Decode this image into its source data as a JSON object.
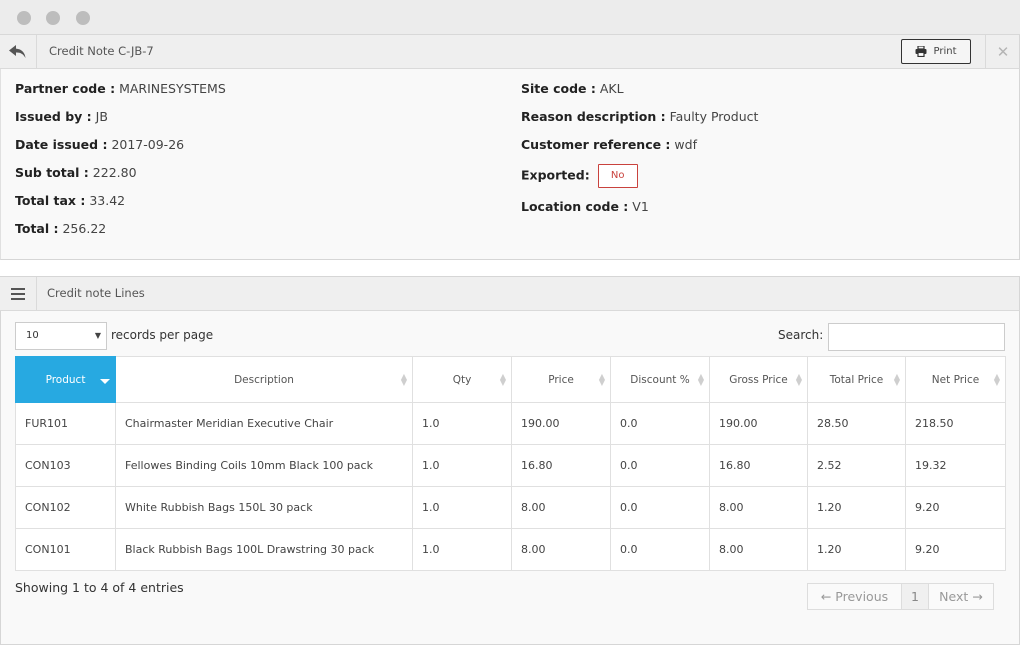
{
  "window": {
    "controls": [
      "close",
      "minimize",
      "maximize"
    ]
  },
  "header": {
    "back_icon": "reply-arrow-icon",
    "title": "Credit Note C-JB-7",
    "print_label": "Print",
    "print_icon": "printer-icon",
    "close_icon": "close-x-icon"
  },
  "details": {
    "left": [
      {
        "label": "Partner code :",
        "value": "MARINESYSTEMS"
      },
      {
        "label": "Issued by :",
        "value": "JB"
      },
      {
        "label": "Date issued :",
        "value": "2017-09-26"
      },
      {
        "label": "Sub total :",
        "value": "222.80"
      },
      {
        "label": "Total tax :",
        "value": "33.42"
      },
      {
        "label": "Total :",
        "value": "256.22"
      }
    ],
    "right": {
      "site_code": {
        "label": "Site code :",
        "value": "AKL"
      },
      "reason": {
        "label": "Reason description :",
        "value": "Faulty Product"
      },
      "customer_ref": {
        "label": "Customer reference :",
        "value": "wdf"
      },
      "exported": {
        "label": "Exported:",
        "value": "No",
        "color": "#c9423d"
      },
      "location_code": {
        "label": "Location code :",
        "value": "V1"
      }
    }
  },
  "lines_panel": {
    "menu_icon": "hamburger-menu-icon",
    "title": "Credit note Lines",
    "records_per_page": {
      "value": "10",
      "label": "records per page"
    },
    "search": {
      "label": "Search:",
      "value": "",
      "placeholder": ""
    },
    "columns": [
      "Product",
      "Description",
      "Qty",
      "Price",
      "Discount %",
      "Gross Price",
      "Total Price",
      "Net Price"
    ],
    "sorted_column": "Product",
    "accent_color": "#27a9e1",
    "rows": [
      [
        "FUR101",
        "Chairmaster Meridian Executive Chair",
        "1.0",
        "190.00",
        "0.0",
        "190.00",
        "28.50",
        "218.50"
      ],
      [
        "CON103",
        "Fellowes Binding Coils 10mm Black 100 pack",
        "1.0",
        "16.80",
        "0.0",
        "16.80",
        "2.52",
        "19.32"
      ],
      [
        "CON102",
        "White Rubbish Bags 150L 30 pack",
        "1.0",
        "8.00",
        "0.0",
        "8.00",
        "1.20",
        "9.20"
      ],
      [
        "CON101",
        "Black Rubbish Bags 100L Drawstring 30 pack",
        "1.0",
        "8.00",
        "0.0",
        "8.00",
        "1.20",
        "9.20"
      ]
    ],
    "showing": "Showing 1 to 4 of 4 entries",
    "pagination": {
      "previous": "← Previous",
      "current": "1",
      "next": "Next →"
    }
  }
}
